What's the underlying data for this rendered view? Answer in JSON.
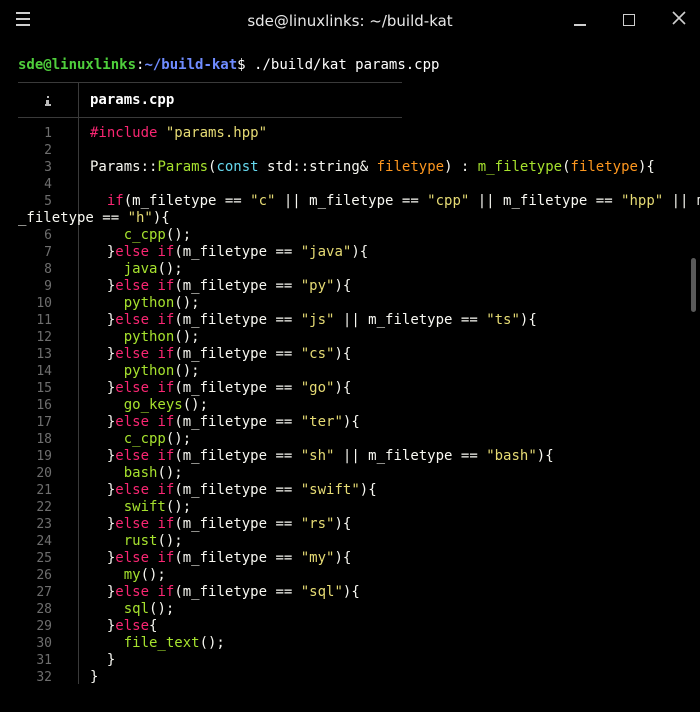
{
  "window": {
    "title": "sde@linuxlinks: ~/build-kat"
  },
  "prompt": {
    "user_host": "sde@linuxlinks",
    "colon": ":",
    "path": "~/build-kat",
    "dollar": "$",
    "command": " ./build/kat params.cpp"
  },
  "file": {
    "name": "params.cpp"
  },
  "code_lines": [
    {
      "n": "1",
      "segs": [
        [
          "kw",
          "#include "
        ],
        [
          "str",
          "\"params.hpp\""
        ]
      ]
    },
    {
      "n": "2",
      "segs": []
    },
    {
      "n": "3",
      "segs": [
        [
          "ns",
          "Params::"
        ],
        [
          "fn",
          "Params"
        ],
        [
          "ns",
          "("
        ],
        [
          "typ",
          "const"
        ],
        [
          "ns",
          " std::string& "
        ],
        [
          "prm",
          "filetype"
        ],
        [
          "ns",
          ") : "
        ],
        [
          "fn",
          "m_filetype"
        ],
        [
          "ns",
          "("
        ],
        [
          "prm",
          "filetype"
        ],
        [
          "ns",
          "){"
        ]
      ]
    },
    {
      "n": "4",
      "segs": []
    },
    {
      "n": "5",
      "segs": [
        [
          "kw",
          "  if"
        ],
        [
          "ns",
          "(m_filetype == "
        ],
        [
          "str",
          "\"c\""
        ],
        [
          "ns",
          " || m_filetype == "
        ],
        [
          "str",
          "\"cpp\""
        ],
        [
          "ns",
          " || m_filetype == "
        ],
        [
          "str",
          "\"hpp\""
        ],
        [
          "ns",
          " || m"
        ]
      ]
    },
    {
      "n": "",
      "wrap": true,
      "segs": [
        [
          "ns",
          "_filetype == "
        ],
        [
          "str",
          "\"h\""
        ],
        [
          "ns",
          "){"
        ]
      ]
    },
    {
      "n": "6",
      "segs": [
        [
          "fn",
          "    c_cpp"
        ],
        [
          "ns",
          "();"
        ]
      ]
    },
    {
      "n": "7",
      "segs": [
        [
          "ns",
          "  }"
        ],
        [
          "kw",
          "else if"
        ],
        [
          "ns",
          "(m_filetype == "
        ],
        [
          "str",
          "\"java\""
        ],
        [
          "ns",
          "){"
        ]
      ]
    },
    {
      "n": "8",
      "segs": [
        [
          "fn",
          "    java"
        ],
        [
          "ns",
          "();"
        ]
      ]
    },
    {
      "n": "9",
      "segs": [
        [
          "ns",
          "  }"
        ],
        [
          "kw",
          "else if"
        ],
        [
          "ns",
          "(m_filetype == "
        ],
        [
          "str",
          "\"py\""
        ],
        [
          "ns",
          "){"
        ]
      ]
    },
    {
      "n": "10",
      "segs": [
        [
          "fn",
          "    python"
        ],
        [
          "ns",
          "();"
        ]
      ]
    },
    {
      "n": "11",
      "segs": [
        [
          "ns",
          "  }"
        ],
        [
          "kw",
          "else if"
        ],
        [
          "ns",
          "(m_filetype == "
        ],
        [
          "str",
          "\"js\""
        ],
        [
          "ns",
          " || m_filetype == "
        ],
        [
          "str",
          "\"ts\""
        ],
        [
          "ns",
          "){"
        ]
      ]
    },
    {
      "n": "12",
      "segs": [
        [
          "fn",
          "    python"
        ],
        [
          "ns",
          "();"
        ]
      ]
    },
    {
      "n": "13",
      "segs": [
        [
          "ns",
          "  }"
        ],
        [
          "kw",
          "else if"
        ],
        [
          "ns",
          "(m_filetype == "
        ],
        [
          "str",
          "\"cs\""
        ],
        [
          "ns",
          "){"
        ]
      ]
    },
    {
      "n": "14",
      "segs": [
        [
          "fn",
          "    python"
        ],
        [
          "ns",
          "();"
        ]
      ]
    },
    {
      "n": "15",
      "segs": [
        [
          "ns",
          "  }"
        ],
        [
          "kw",
          "else if"
        ],
        [
          "ns",
          "(m_filetype == "
        ],
        [
          "str",
          "\"go\""
        ],
        [
          "ns",
          "){"
        ]
      ]
    },
    {
      "n": "16",
      "segs": [
        [
          "fn",
          "    go_keys"
        ],
        [
          "ns",
          "();"
        ]
      ]
    },
    {
      "n": "17",
      "segs": [
        [
          "ns",
          "  }"
        ],
        [
          "kw",
          "else if"
        ],
        [
          "ns",
          "(m_filetype == "
        ],
        [
          "str",
          "\"ter\""
        ],
        [
          "ns",
          "){"
        ]
      ]
    },
    {
      "n": "18",
      "segs": [
        [
          "fn",
          "    c_cpp"
        ],
        [
          "ns",
          "();"
        ]
      ]
    },
    {
      "n": "19",
      "segs": [
        [
          "ns",
          "  }"
        ],
        [
          "kw",
          "else if"
        ],
        [
          "ns",
          "(m_filetype == "
        ],
        [
          "str",
          "\"sh\""
        ],
        [
          "ns",
          " || m_filetype == "
        ],
        [
          "str",
          "\"bash\""
        ],
        [
          "ns",
          "){"
        ]
      ]
    },
    {
      "n": "20",
      "segs": [
        [
          "fn",
          "    bash"
        ],
        [
          "ns",
          "();"
        ]
      ]
    },
    {
      "n": "21",
      "segs": [
        [
          "ns",
          "  }"
        ],
        [
          "kw",
          "else if"
        ],
        [
          "ns",
          "(m_filetype == "
        ],
        [
          "str",
          "\"swift\""
        ],
        [
          "ns",
          "){"
        ]
      ]
    },
    {
      "n": "22",
      "segs": [
        [
          "fn",
          "    swift"
        ],
        [
          "ns",
          "();"
        ]
      ]
    },
    {
      "n": "23",
      "segs": [
        [
          "ns",
          "  }"
        ],
        [
          "kw",
          "else if"
        ],
        [
          "ns",
          "(m_filetype == "
        ],
        [
          "str",
          "\"rs\""
        ],
        [
          "ns",
          "){"
        ]
      ]
    },
    {
      "n": "24",
      "segs": [
        [
          "fn",
          "    rust"
        ],
        [
          "ns",
          "();"
        ]
      ]
    },
    {
      "n": "25",
      "segs": [
        [
          "ns",
          "  }"
        ],
        [
          "kw",
          "else if"
        ],
        [
          "ns",
          "(m_filetype == "
        ],
        [
          "str",
          "\"my\""
        ],
        [
          "ns",
          "){"
        ]
      ]
    },
    {
      "n": "26",
      "segs": [
        [
          "fn",
          "    my"
        ],
        [
          "ns",
          "();"
        ]
      ]
    },
    {
      "n": "27",
      "segs": [
        [
          "ns",
          "  }"
        ],
        [
          "kw",
          "else if"
        ],
        [
          "ns",
          "(m_filetype == "
        ],
        [
          "str",
          "\"sql\""
        ],
        [
          "ns",
          "){"
        ]
      ]
    },
    {
      "n": "28",
      "segs": [
        [
          "fn",
          "    sql"
        ],
        [
          "ns",
          "();"
        ]
      ]
    },
    {
      "n": "29",
      "segs": [
        [
          "ns",
          "  }"
        ],
        [
          "kw",
          "else"
        ],
        [
          "ns",
          "{"
        ]
      ]
    },
    {
      "n": "30",
      "segs": [
        [
          "fn",
          "    file_text"
        ],
        [
          "ns",
          "();"
        ]
      ]
    },
    {
      "n": "31",
      "segs": [
        [
          "ns",
          "  }"
        ]
      ]
    },
    {
      "n": "32",
      "segs": [
        [
          "ns",
          "}"
        ]
      ]
    }
  ],
  "colors": {
    "keyword": "#f92672",
    "string": "#e6db74",
    "function": "#a6e22e",
    "type": "#66d9ef",
    "param": "#fd971f",
    "prompt_user": "#4fcf3c",
    "prompt_path": "#6f8cff"
  }
}
